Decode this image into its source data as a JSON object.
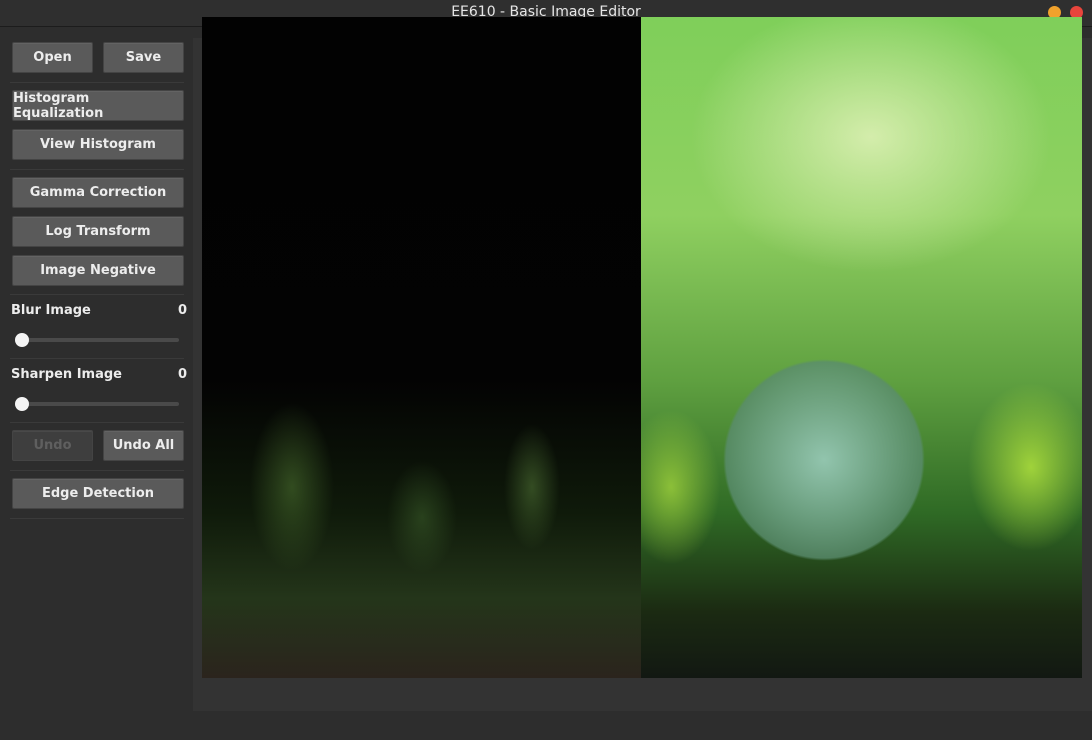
{
  "window": {
    "title": "EE610 - Basic Image Editor",
    "controls": [
      "minimize",
      "close"
    ],
    "colors": {
      "minimize": "#f0a22c",
      "close": "#e8453c"
    }
  },
  "sidebar": {
    "open_label": "Open",
    "save_label": "Save",
    "histogram_equalization_label": "Histogram Equalization",
    "view_histogram_label": "View Histogram",
    "gamma_correction_label": "Gamma Correction",
    "log_transform_label": "Log Transform",
    "image_negative_label": "Image Negative",
    "blur": {
      "label": "Blur Image",
      "value": "0"
    },
    "sharpen": {
      "label": "Sharpen Image",
      "value": "0"
    },
    "undo_label": "Undo",
    "undo_all_label": "Undo All",
    "edge_detection_label": "Edge Detection"
  },
  "canvas": {
    "left_image": "edge-detected forest scene with glass globe",
    "right_image": "original glass globe on moss with ferns"
  }
}
